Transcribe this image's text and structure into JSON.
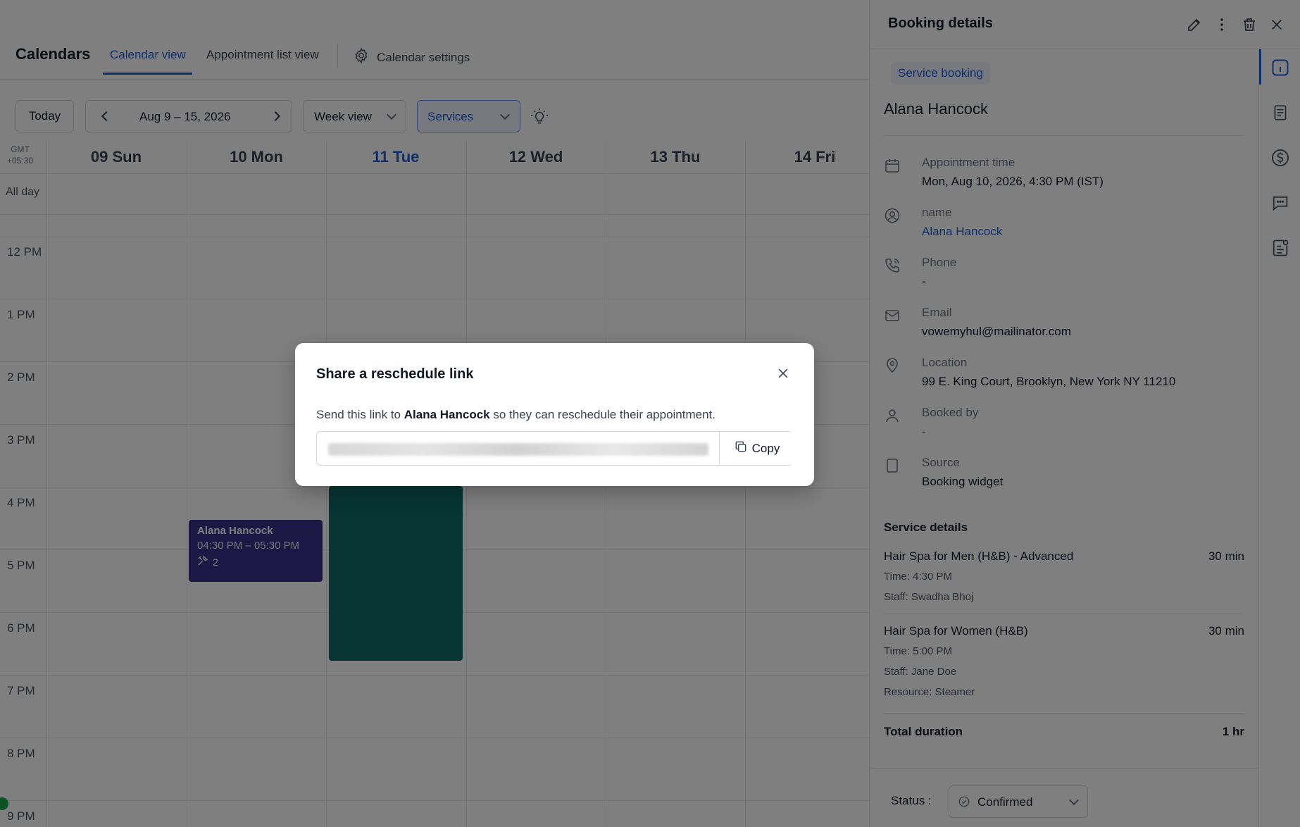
{
  "header": {
    "title": "Calendars",
    "tabs": [
      {
        "label": "Calendar view",
        "active": true
      },
      {
        "label": "Appointment list view",
        "active": false
      }
    ],
    "settings_label": "Calendar settings"
  },
  "toolbar": {
    "today_label": "Today",
    "date_range": "Aug 9 – 15, 2026",
    "view_label": "Week view",
    "filter_label": "Services"
  },
  "calendar": {
    "timezone_line1": "GMT",
    "timezone_line2": "+05:30",
    "allday_label": "All day",
    "days": [
      {
        "label": "09 Sun"
      },
      {
        "label": "10 Mon"
      },
      {
        "label": "11 Tue",
        "today": true
      },
      {
        "label": "12 Wed"
      },
      {
        "label": "13 Thu"
      },
      {
        "label": "14 Fri"
      }
    ],
    "hours": [
      "12 PM",
      "1 PM",
      "2 PM",
      "3 PM",
      "4 PM",
      "5 PM",
      "6 PM",
      "7 PM",
      "8 PM",
      "9 PM"
    ],
    "event": {
      "name": "Alana Hancock",
      "time": "04:30 PM – 05:30 PM",
      "count": "2"
    }
  },
  "panel": {
    "title": "Booking details",
    "badge": "Service booking",
    "customer_name": "Alana Hancock",
    "fields": {
      "appointment_label": "Appointment time",
      "appointment_value": "Mon, Aug 10, 2026, 4:30 PM (IST)",
      "name_label": "name",
      "name_value": "Alana Hancock",
      "phone_label": "Phone",
      "phone_value": "-",
      "email_label": "Email",
      "email_value": "vowemyhul@mailinator.com",
      "location_label": "Location",
      "location_value": "99 E. King Court, Brooklyn, New York NY 11210",
      "booked_by_label": "Booked by",
      "booked_by_value": "-",
      "source_label": "Source",
      "source_value": "Booking widget"
    },
    "service_details_title": "Service details",
    "services": [
      {
        "name": "Hair Spa for Men (H&B) - Advanced",
        "duration": "30 min",
        "time": "Time: 4:30 PM",
        "staff": "Staff: Swadha Bhoj"
      },
      {
        "name": "Hair Spa for Women (H&B)",
        "duration": "30 min",
        "time": "Time: 5:00 PM",
        "staff": "Staff: Jane Doe",
        "resource": "Resource: Steamer"
      }
    ],
    "total_label": "Total duration",
    "total_value": "1 hr",
    "status_label": "Status :",
    "status_value": "Confirmed"
  },
  "modal": {
    "title": "Share a reschedule link",
    "desc_before": "Send this link to ",
    "desc_name": "Alana Hancock",
    "desc_after": " so they can reschedule their appointment.",
    "copy_label": "Copy"
  },
  "colors": {
    "accent": "#1d5fd8",
    "event_purple": "#3b2f8a",
    "event_teal": "#0d6b65"
  }
}
